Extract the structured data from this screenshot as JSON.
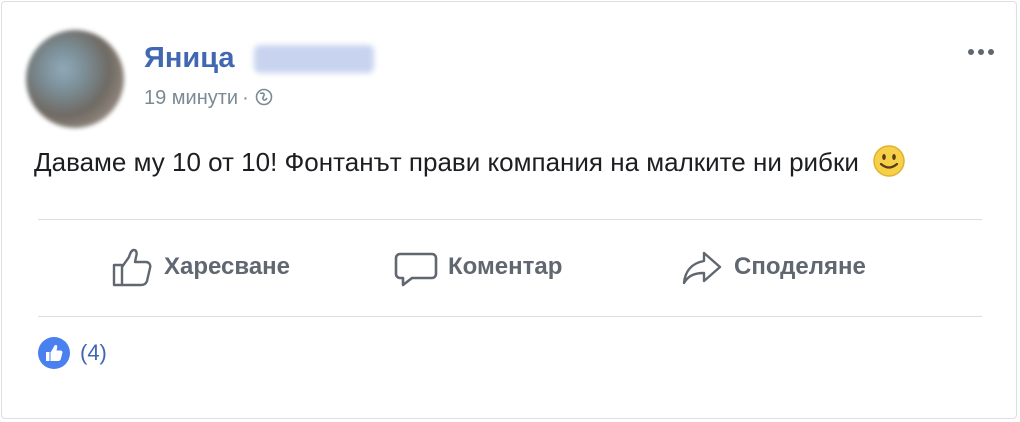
{
  "post": {
    "author_name": "Яница",
    "timestamp": "19 минути",
    "separator": "·",
    "audience_icon": "globe-icon",
    "text": "Даваме му 10 от 10! Фонтанът прави компания на малките ни рибки",
    "emoji_icon": "smile-emoji-icon",
    "more_icon": "more-options-icon"
  },
  "actions": {
    "like_label": "Харесване",
    "comment_label": "Коментар",
    "share_label": "Споделяне"
  },
  "reactions": {
    "icon": "like-reaction-icon",
    "count": "(4)"
  },
  "colors": {
    "brand_blue": "#4267b2",
    "action_gray": "#606770",
    "meta_gray": "#7b8a94",
    "like_badge": "#4a80f0",
    "divider": "#dadde1"
  }
}
